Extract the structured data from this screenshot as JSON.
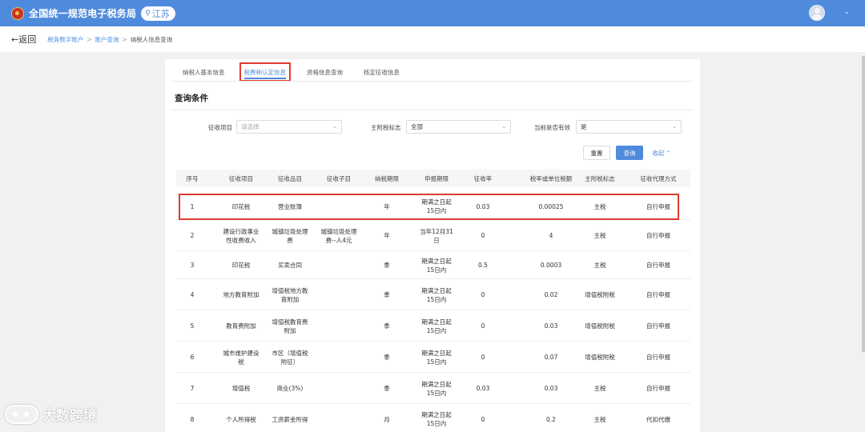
{
  "header": {
    "app_title": "全国统一规范电子税务局",
    "region": "江苏",
    "region_icon": "location-pin-icon",
    "user_icon": "user-avatar-icon",
    "brand_color": "#4f8bdc"
  },
  "nav": {
    "back_label": "←返回",
    "breadcrumb": [
      "税务数字账户",
      "账户查询",
      "纳税人信息查询"
    ],
    "separator": ">"
  },
  "tabs": [
    "纳税人基本信息",
    "税费种认定信息",
    "资格信息查询",
    "核定征收信息"
  ],
  "active_tab": 1,
  "query": {
    "title": "查询条件",
    "fields": [
      {
        "label": "征收项目",
        "value": "",
        "placeholder": "请选择"
      },
      {
        "label": "主附税标志",
        "value": "全部",
        "placeholder": ""
      },
      {
        "label": "当前是否有效",
        "value": "是",
        "placeholder": ""
      }
    ],
    "reset_label": "重置",
    "query_label": "查询",
    "collapse_label": "收起"
  },
  "table": {
    "headers": [
      "序号",
      "征收项目",
      "征收品目",
      "征收子目",
      "纳税期限",
      "申报期限",
      "征收率",
      "税率或单位税额",
      "主附税标志",
      "征收代理方式"
    ],
    "rows": [
      [
        "1",
        "印花税",
        "营业账簿",
        "",
        "年",
        "期满之日起\n15日内",
        "0.03",
        "0.00025",
        "主税",
        "自行申报"
      ],
      [
        "2",
        "建设行政事业\n性收费收入",
        "城镇垃圾处理\n费",
        "城镇垃圾处理\n费--人4元",
        "年",
        "当年12月31\n日",
        "0",
        "4",
        "主税",
        "自行申报"
      ],
      [
        "3",
        "印花税",
        "买卖合同",
        "",
        "季",
        "期满之日起\n15日内",
        "0.5",
        "0.0003",
        "主税",
        "自行申报"
      ],
      [
        "4",
        "地方教育附加",
        "增值税地方教\n育附加",
        "",
        "季",
        "期满之日起\n15日内",
        "0",
        "0.02",
        "增值税附税",
        "自行申报"
      ],
      [
        "5",
        "教育费附加",
        "增值税教育费\n附加",
        "",
        "季",
        "期满之日起\n15日内",
        "0",
        "0.03",
        "增值税附税",
        "自行申报"
      ],
      [
        "6",
        "城市维护建设\n税",
        "市区（增值税\n附征）",
        "",
        "季",
        "期满之日起\n15日内",
        "0",
        "0.07",
        "增值税附税",
        "自行申报"
      ],
      [
        "7",
        "增值税",
        "商业(3%)",
        "",
        "季",
        "期满之日起\n15日内",
        "0.03",
        "0.03",
        "主税",
        "自行申报"
      ],
      [
        "8",
        "个人所得税",
        "工资薪金所得",
        "",
        "月",
        "期满之日起\n15日内",
        "0",
        "0.2",
        "主税",
        "代扣代缴"
      ]
    ]
  },
  "watermark": "大数跨境"
}
